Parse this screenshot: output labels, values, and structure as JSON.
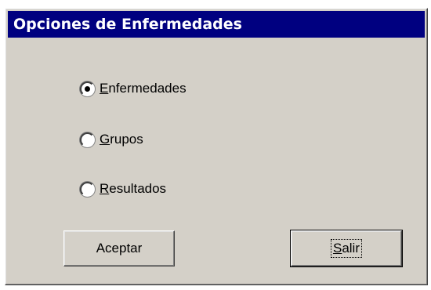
{
  "window": {
    "title": "Opciones de Enfermedades"
  },
  "options": [
    {
      "accel": "E",
      "rest": "nfermedades",
      "selected": true
    },
    {
      "accel": "G",
      "rest": "rupos",
      "selected": false
    },
    {
      "accel": "R",
      "rest": "esultados",
      "selected": false
    }
  ],
  "buttons": {
    "accept_label": "Aceptar",
    "exit_accel": "S",
    "exit_rest": "alir"
  },
  "colors": {
    "titlebar": "#000080",
    "face": "#d4d0c8"
  }
}
